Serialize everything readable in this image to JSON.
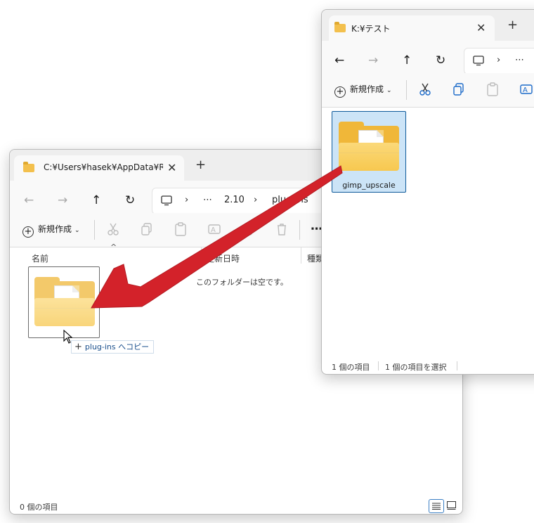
{
  "back_window": {
    "tab_title": "C:¥Users¥hasek¥AppData¥Roa",
    "tab_close": "✕",
    "new_tab": "+",
    "nav": {
      "back": "←",
      "forward": "→",
      "up": "↑",
      "refresh": "↻"
    },
    "address": {
      "chevron": "›",
      "ellipsis": "⋯",
      "crumb1": "2.10",
      "crumb2": "plug-ins"
    },
    "command": {
      "new_label": "新規作成",
      "more": "⋯"
    },
    "columns": {
      "name": "名前",
      "date": "更新日時",
      "type": "種類"
    },
    "empty_text": "このフォルダーは空です。",
    "drag_tooltip": "plug-ins へコピー",
    "status": "0 個の項目"
  },
  "front_window": {
    "tab_title": "K:¥テスト",
    "tab_close": "✕",
    "new_tab": "+",
    "nav": {
      "back": "←",
      "forward": "→",
      "up": "↑",
      "refresh": "↻"
    },
    "address": {
      "chevron": "›",
      "ellipsis": "⋯"
    },
    "command": {
      "new_label": "新規作成"
    },
    "folder_label": "gimp_upscale",
    "status_count": "1 個の項目",
    "status_selected": "1 個の項目を選択"
  },
  "colors": {
    "arrow": "#d3222a",
    "selection": "#cce4f7",
    "selection_border": "#0f5a9a"
  },
  "icons": [
    "folder-icon",
    "cut-icon",
    "copy-icon",
    "paste-icon",
    "rename-icon",
    "share-icon",
    "delete-icon",
    "pc-icon",
    "details-view-icon",
    "tiles-view-icon"
  ]
}
